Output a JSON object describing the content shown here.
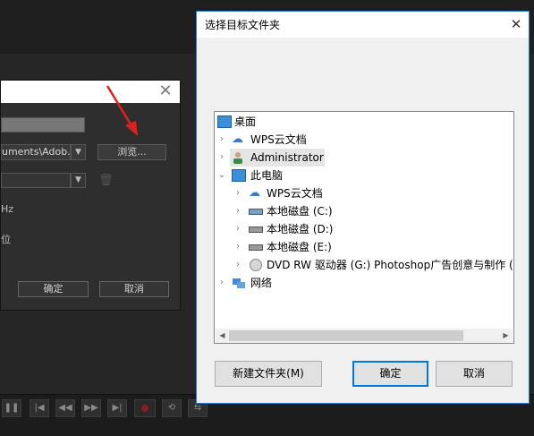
{
  "adobe_dialog": {
    "path_value": "uments\\Adob...",
    "browse_label": "浏览...",
    "hz_label": "Hz",
    "wei_label": "位",
    "ok_label": "确定",
    "cancel_label": "取消"
  },
  "folder_dialog": {
    "title": "选择目标文件夹",
    "tree": [
      {
        "label": "桌面"
      },
      {
        "label": "WPS云文档"
      },
      {
        "label": "Administrator"
      },
      {
        "label": "此电脑"
      },
      {
        "label": "WPS云文档"
      },
      {
        "label": "本地磁盘 (C:)"
      },
      {
        "label": "本地磁盘 (D:)"
      },
      {
        "label": "本地磁盘 (E:)"
      },
      {
        "label": "DVD RW 驱动器 (G:) Photoshop广告创意与制作 ("
      },
      {
        "label": "网络"
      }
    ],
    "new_folder_label": "新建文件夹(M)",
    "ok_label": "确定",
    "cancel_label": "取消"
  },
  "colors": {
    "accent": "#0078d7",
    "arrow": "#e02020"
  }
}
